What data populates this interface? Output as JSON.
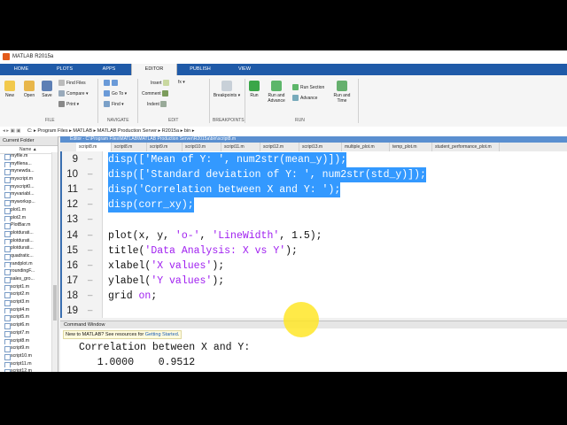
{
  "window": {
    "title": "MATLAB R2015a"
  },
  "ribbon": {
    "tabs": [
      "HOME",
      "PLOTS",
      "APPS",
      "EDITOR",
      "PUBLISH",
      "VIEW"
    ],
    "active_tab": "EDITOR",
    "file": {
      "new": "New",
      "open": "Open",
      "save": "Save",
      "find_files": "Find Files",
      "compare": "Compare",
      "print": "Print",
      "label": "FILE"
    },
    "navigate": {
      "go_to": "Go To",
      "find": "Find",
      "label": "NAVIGATE"
    },
    "edit": {
      "insert": "Insert",
      "comment": "Comment",
      "indent": "Indent",
      "fx": "fx",
      "label": "EDIT"
    },
    "breakpoints": {
      "breakpoints": "Breakpoints",
      "label": "BREAKPOINTS"
    },
    "run": {
      "run": "Run",
      "run_and_advance": "Run and Advance",
      "run_section": "Run Section",
      "advance": "Advance",
      "run_and_time": "Run and Time",
      "label": "RUN"
    }
  },
  "address_bar": {
    "path": "C: ▸ Program Files ▸ MATLAB ▸ MATLAB Production Server ▸ R2015a ▸ bin ▸"
  },
  "current_folder": {
    "title": "Current Folder",
    "column": "Name ▲",
    "files": [
      "myfile.m",
      "myfilena...",
      "mynewda...",
      "myscript.m",
      "myscript0...",
      "myvariabl...",
      "myworksp...",
      "plot1.m",
      "plot2.m",
      "PlotBar.m",
      "plotdurati...",
      "plotdurati...",
      "plotdurati...",
      "quadratic...",
      "randplot.m",
      "roundingF...",
      "sales_gro...",
      "script1.m",
      "script2.m",
      "script3.m",
      "script4.m",
      "script5.m",
      "script6.m",
      "script7.m",
      "script8.m",
      "script9.m",
      "script10.m",
      "script11.m",
      "script12.m"
    ]
  },
  "editor": {
    "title": "Editor - C:\\Program Files\\MATLAB\\MATLAB Production Server\\R2015a\\bin\\script8.m",
    "tabs": [
      "script8.m",
      "script8.m",
      "script9.m",
      "script10.m",
      "script11.m",
      "script12.m",
      "script13.m",
      "multiple_plot.m",
      "temp_plot.m",
      "student_performance_plot.m"
    ],
    "active_tab_index": 0,
    "lines": [
      {
        "num": "9",
        "selected": true,
        "parts": [
          [
            "disp([",
            ""
          ],
          [
            "'Mean of Y: '",
            "str"
          ],
          [
            ", num2str(mean_y)]);",
            ""
          ]
        ]
      },
      {
        "num": "10",
        "selected": true,
        "parts": [
          [
            "disp([",
            ""
          ],
          [
            "'Standard deviation of Y: '",
            "str"
          ],
          [
            ", num2str(std_y)]);",
            ""
          ]
        ]
      },
      {
        "num": "11",
        "selected": true,
        "parts": [
          [
            "disp(",
            ""
          ],
          [
            "'Correlation between X and Y: '",
            "str"
          ],
          [
            ");",
            ""
          ]
        ]
      },
      {
        "num": "12",
        "selected": true,
        "parts": [
          [
            "disp(corr_xy);",
            ""
          ]
        ]
      },
      {
        "num": "13",
        "selected": false,
        "parts": []
      },
      {
        "num": "14",
        "selected": false,
        "parts": [
          [
            "plot(x, y, ",
            ""
          ],
          [
            "'o-'",
            "str"
          ],
          [
            ", ",
            ""
          ],
          [
            "'LineWidth'",
            "str"
          ],
          [
            ", 1.5);",
            ""
          ]
        ]
      },
      {
        "num": "15",
        "selected": false,
        "parts": [
          [
            "title(",
            ""
          ],
          [
            "'Data Analysis: X vs Y'",
            "str"
          ],
          [
            ");",
            ""
          ]
        ]
      },
      {
        "num": "16",
        "selected": false,
        "parts": [
          [
            "xlabel(",
            ""
          ],
          [
            "'X values'",
            "str"
          ],
          [
            ");",
            ""
          ]
        ]
      },
      {
        "num": "17",
        "selected": false,
        "parts": [
          [
            "ylabel(",
            ""
          ],
          [
            "'Y values'",
            "str"
          ],
          [
            ");",
            ""
          ]
        ]
      },
      {
        "num": "18",
        "selected": false,
        "parts": [
          [
            "grid ",
            ""
          ],
          [
            "on",
            "str"
          ],
          [
            ";",
            ""
          ]
        ]
      },
      {
        "num": "19",
        "selected": false,
        "parts": []
      }
    ]
  },
  "command_window": {
    "title": "Command Window",
    "notice_prefix": "New to MATLAB? See resources for ",
    "notice_link": "Getting Started",
    "notice_suffix": ".",
    "output_line1": "Correlation between X and Y:",
    "output_line2": "   1.0000    0.9512"
  },
  "colors": {
    "ribbon_blue": "#1f5aa8",
    "selection": "#3399ff",
    "string_purple": "#a020f0",
    "editor_title": "#5a8fd0"
  }
}
